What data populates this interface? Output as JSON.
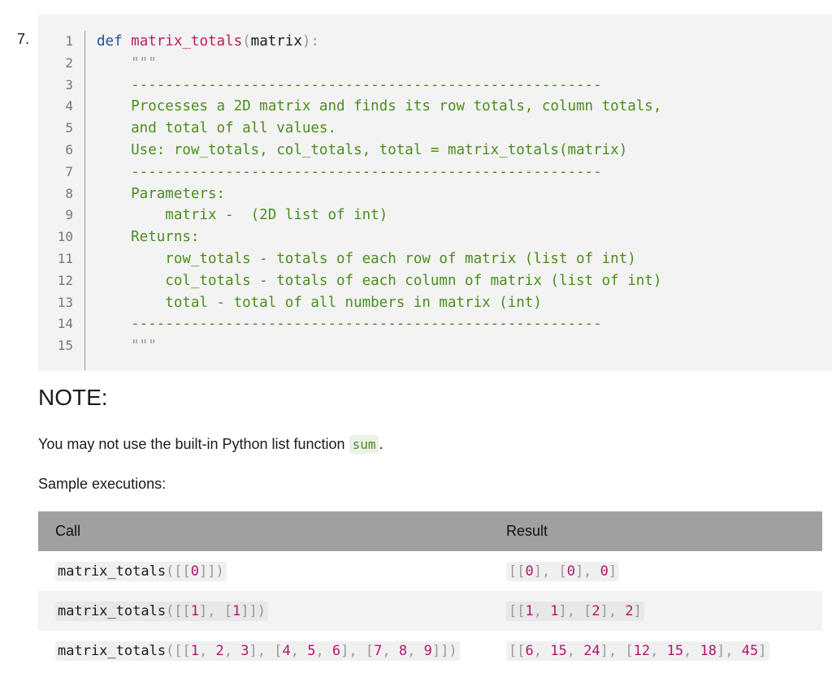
{
  "question_number": "7.",
  "code": {
    "line_numbers": [
      "1",
      "2",
      "3",
      "4",
      "5",
      "6",
      "7",
      "8",
      "9",
      "10",
      "11",
      "12",
      "13",
      "14",
      "15"
    ],
    "lines": [
      [
        {
          "t": "def ",
          "c": "kw"
        },
        {
          "t": "matrix_totals",
          "c": "fn"
        },
        {
          "t": "(",
          "c": "punct"
        },
        {
          "t": "matrix",
          "c": "plain"
        },
        {
          "t": "):",
          "c": "punct"
        }
      ],
      [
        {
          "t": "    \"\"\"",
          "c": "punct"
        }
      ],
      [
        {
          "t": "    -------------------------------------------------------",
          "c": "doc"
        }
      ],
      [
        {
          "t": "    Processes a 2D matrix and finds its row totals, column totals,",
          "c": "doc"
        }
      ],
      [
        {
          "t": "    and total of all values.",
          "c": "doc"
        }
      ],
      [
        {
          "t": "    Use: row_totals, col_totals, total = matrix_totals(matrix)",
          "c": "doc"
        }
      ],
      [
        {
          "t": "    -------------------------------------------------------",
          "c": "doc"
        }
      ],
      [
        {
          "t": "    Parameters:",
          "c": "doc"
        }
      ],
      [
        {
          "t": "        matrix -  (2D list of int)",
          "c": "doc"
        }
      ],
      [
        {
          "t": "    Returns:",
          "c": "doc"
        }
      ],
      [
        {
          "t": "        row_totals - totals of each row of matrix (list of int)",
          "c": "doc"
        }
      ],
      [
        {
          "t": "        col_totals - totals of each column of matrix (list of int)",
          "c": "doc"
        }
      ],
      [
        {
          "t": "        total - total of all numbers in matrix (int)",
          "c": "doc"
        }
      ],
      [
        {
          "t": "    -------------------------------------------------------",
          "c": "doc"
        }
      ],
      [
        {
          "t": "    \"\"\"",
          "c": "punct"
        }
      ]
    ]
  },
  "note": {
    "heading": "NOTE:",
    "text_before": "You may not use the built-in Python list function ",
    "code": "sum",
    "text_after": "."
  },
  "sample_label": "Sample executions:",
  "table": {
    "headers": [
      "Call",
      "Result"
    ],
    "rows": [
      {
        "call": [
          {
            "t": "matrix_totals",
            "c": "nm"
          },
          {
            "t": "([[",
            "c": "br"
          },
          {
            "t": "0",
            "c": "num"
          },
          {
            "t": "]])",
            "c": "br"
          }
        ],
        "result": [
          {
            "t": "[[",
            "c": "br"
          },
          {
            "t": "0",
            "c": "num"
          },
          {
            "t": "], [",
            "c": "br"
          },
          {
            "t": "0",
            "c": "num"
          },
          {
            "t": "], ",
            "c": "br"
          },
          {
            "t": "0",
            "c": "num"
          },
          {
            "t": "]",
            "c": "br"
          }
        ]
      },
      {
        "call": [
          {
            "t": "matrix_totals",
            "c": "nm"
          },
          {
            "t": "([[",
            "c": "br"
          },
          {
            "t": "1",
            "c": "num"
          },
          {
            "t": "], [",
            "c": "br"
          },
          {
            "t": "1",
            "c": "num"
          },
          {
            "t": "]])",
            "c": "br"
          }
        ],
        "result": [
          {
            "t": "[[",
            "c": "br"
          },
          {
            "t": "1",
            "c": "num"
          },
          {
            "t": ", ",
            "c": "br"
          },
          {
            "t": "1",
            "c": "num"
          },
          {
            "t": "], [",
            "c": "br"
          },
          {
            "t": "2",
            "c": "num"
          },
          {
            "t": "], ",
            "c": "br"
          },
          {
            "t": "2",
            "c": "num"
          },
          {
            "t": "]",
            "c": "br"
          }
        ]
      },
      {
        "call": [
          {
            "t": "matrix_totals",
            "c": "nm"
          },
          {
            "t": "([[",
            "c": "br"
          },
          {
            "t": "1",
            "c": "num"
          },
          {
            "t": ", ",
            "c": "br"
          },
          {
            "t": "2",
            "c": "num"
          },
          {
            "t": ", ",
            "c": "br"
          },
          {
            "t": "3",
            "c": "num"
          },
          {
            "t": "], [",
            "c": "br"
          },
          {
            "t": "4",
            "c": "num"
          },
          {
            "t": ", ",
            "c": "br"
          },
          {
            "t": "5",
            "c": "num"
          },
          {
            "t": ", ",
            "c": "br"
          },
          {
            "t": "6",
            "c": "num"
          },
          {
            "t": "], [",
            "c": "br"
          },
          {
            "t": "7",
            "c": "num"
          },
          {
            "t": ", ",
            "c": "br"
          },
          {
            "t": "8",
            "c": "num"
          },
          {
            "t": ", ",
            "c": "br"
          },
          {
            "t": "9",
            "c": "num"
          },
          {
            "t": "]])",
            "c": "br"
          }
        ],
        "result": [
          {
            "t": "[[",
            "c": "br"
          },
          {
            "t": "6",
            "c": "num"
          },
          {
            "t": ", ",
            "c": "br"
          },
          {
            "t": "15",
            "c": "num"
          },
          {
            "t": ", ",
            "c": "br"
          },
          {
            "t": "24",
            "c": "num"
          },
          {
            "t": "], [",
            "c": "br"
          },
          {
            "t": "12",
            "c": "num"
          },
          {
            "t": ", ",
            "c": "br"
          },
          {
            "t": "15",
            "c": "num"
          },
          {
            "t": ", ",
            "c": "br"
          },
          {
            "t": "18",
            "c": "num"
          },
          {
            "t": "], ",
            "c": "br"
          },
          {
            "t": "45",
            "c": "num"
          },
          {
            "t": "]",
            "c": "br"
          }
        ]
      }
    ]
  }
}
